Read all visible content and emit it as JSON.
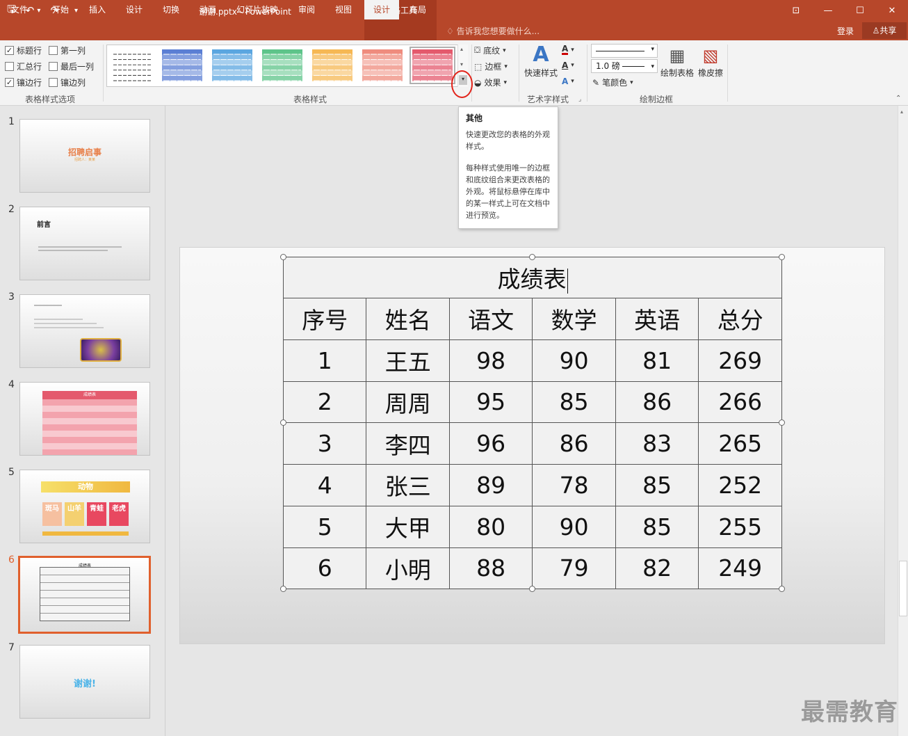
{
  "titlebar": {
    "doc_title": "谢谢.pptx - PowerPoint",
    "context_group": "表格工具",
    "qat": {
      "save": "🖫",
      "undo": "↶",
      "undo_drop": "▾",
      "redo": "↷",
      "customize": "▾"
    },
    "window_buttons": {
      "restore_ribbon": "⊡",
      "minimize": "—",
      "maximize": "☐",
      "close": "✕"
    }
  },
  "tabs": [
    "文件",
    "开始",
    "插入",
    "设计",
    "切换",
    "动画",
    "幻灯片放映",
    "审阅",
    "视图",
    "设计",
    "布局"
  ],
  "active_tab_index": 9,
  "tell_me": "告诉我您想要做什么...",
  "login": "登录",
  "share": "共享",
  "ribbon": {
    "options": {
      "header_row": "标题行",
      "first_column": "第一列",
      "total_row": "汇总行",
      "last_column": "最后一列",
      "banded_rows": "镶边行",
      "banded_columns": "镶边列",
      "checked": {
        "header_row": true,
        "first_column": false,
        "total_row": false,
        "last_column": false,
        "banded_rows": true,
        "banded_columns": false
      },
      "group_label": "表格样式选项"
    },
    "styles": {
      "group_label": "表格样式",
      "swatch_colors": [
        "#ffffff",
        "#5b7fd4",
        "#5ba6e0",
        "#5ec48a",
        "#f6b854",
        "#ef8c7e",
        "#e45a6d"
      ],
      "shading": "底纹",
      "borders": "边框",
      "effects": "效果"
    },
    "wordart": {
      "quick_styles": "快速样式",
      "group_label": "艺术字样式"
    },
    "draw_borders": {
      "weight": "1.0 磅",
      "pen_color": "笔颜色",
      "draw_table": "绘制表格",
      "eraser": "橡皮擦",
      "group_label": "绘制边框"
    }
  },
  "tooltip": {
    "title": "其他",
    "line1": "快速更改您的表格的外观样式。",
    "line2": "每种样式使用唯一的边框和底纹组合来更改表格的外观。将鼠标悬停在库中的某一样式上可在文档中进行预览。"
  },
  "thumbnails": [
    {
      "num": "1",
      "title": "招聘启事",
      "sub": "招聘人：某某"
    },
    {
      "num": "2",
      "title": "前言"
    },
    {
      "num": "3"
    },
    {
      "num": "4",
      "title": "成绩表"
    },
    {
      "num": "5",
      "title": "动物",
      "cells": [
        "斑马",
        "山羊",
        "青蛙",
        "老虎"
      ]
    },
    {
      "num": "6",
      "title": "成绩表"
    },
    {
      "num": "7",
      "title": "谢谢!"
    }
  ],
  "table": {
    "title": "成绩表",
    "headers": [
      "序号",
      "姓名",
      "语文",
      "数学",
      "英语",
      "总分"
    ],
    "rows": [
      [
        "1",
        "王五",
        "98",
        "90",
        "81",
        "269"
      ],
      [
        "2",
        "周周",
        "95",
        "85",
        "86",
        "266"
      ],
      [
        "3",
        "李四",
        "96",
        "86",
        "83",
        "265"
      ],
      [
        "4",
        "张三",
        "89",
        "78",
        "85",
        "252"
      ],
      [
        "5",
        "大甲",
        "80",
        "90",
        "85",
        "255"
      ],
      [
        "6",
        "小明",
        "88",
        "79",
        "82",
        "249"
      ]
    ]
  },
  "watermark": "最需教育"
}
